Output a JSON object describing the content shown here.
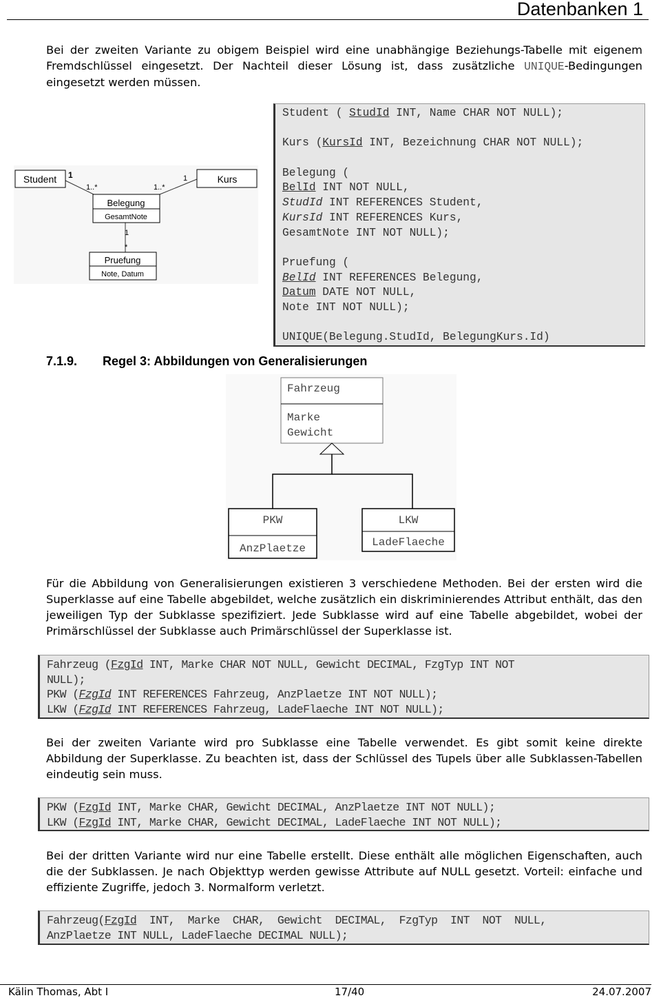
{
  "header": {
    "title": "Datenbanken 1"
  },
  "intro": {
    "before": "Bei der zweiten Variante zu obigem Beispiel wird eine unabhängige Beziehungs-Tabelle mit eigenem Fremdschlüssel eingesetzt. Der Nachteil dieser Lösung ist, dass zusätzliche ",
    "code": "UNIQUE",
    "after": "-Bedingungen eingesetzt werden müssen."
  },
  "uml1": {
    "classes": {
      "student": "Student",
      "kurs": "Kurs",
      "belegung": "Belegung",
      "belegung_attr": "GesamtNote",
      "pruefung": "Pruefung",
      "pruefung_attr": "Note, Datum"
    },
    "multiplicities": {
      "student_end": "1",
      "belegung_student_end": "1..*",
      "belegung_kurs_end": "1..*",
      "kurs_end": "1",
      "belegung_pruefung_end": "1",
      "pruefung_end": "*"
    }
  },
  "code1": [
    [
      {
        "t": "Student ( "
      },
      {
        "t": "StudId",
        "u": true
      },
      {
        "t": " INT, Name CHAR NOT NULL);"
      }
    ],
    [],
    [
      {
        "t": "Kurs ("
      },
      {
        "t": "KursId",
        "u": true
      },
      {
        "t": " INT, Bezeichnung CHAR NOT NULL);"
      }
    ],
    [],
    [
      {
        "t": "Belegung ("
      }
    ],
    [
      {
        "t": "BelId",
        "u": true
      },
      {
        "t": " INT NOT NULL,"
      }
    ],
    [
      {
        "t": "StudId",
        "i": true
      },
      {
        "t": " INT REFERENCES Student,"
      }
    ],
    [
      {
        "t": "KursId",
        "i": true
      },
      {
        "t": " INT REFERENCES Kurs,"
      }
    ],
    [
      {
        "t": "GesamtNote INT NOT NULL);"
      }
    ],
    [],
    [
      {
        "t": "Pruefung ("
      }
    ],
    [
      {
        "t": "BelId",
        "u": true,
        "i": true
      },
      {
        "t": " INT REFERENCES Belegung,"
      }
    ],
    [
      {
        "t": "Datum",
        "u": true
      },
      {
        "t": " DATE NOT NULL,"
      }
    ],
    [
      {
        "t": "Note INT NOT NULL);"
      }
    ],
    [],
    [
      {
        "t": "UNIQUE(Belegung.StudId, BelegungKurs.Id)"
      }
    ]
  ],
  "section": {
    "number": "7.1.9.",
    "title": "Regel 3: Abbildungen von Generalisierungen"
  },
  "uml2": {
    "super": "Fahrzeug",
    "super_attrs": [
      "Marke",
      "Gewicht"
    ],
    "sub1": "PKW",
    "sub1_attr": "AnzPlaetze",
    "sub2": "LKW",
    "sub2_attr": "LadeFlaeche"
  },
  "para1": "Für die Abbildung von Generalisierungen existieren 3 verschiedene Methoden. Bei der ersten wird die Superklasse auf eine  Tabelle abgebildet, welche zusätzlich ein diskriminierendes Attribut enthält, das den jeweiligen Typ der Subklasse spezifiziert. Jede Subklasse wird auf eine Tabelle abgebildet, wobei der Primärschlüssel der Subklasse auch Primärschlüssel der Superklasse ist.",
  "code2": [
    [
      {
        "t": "Fahrzeug ("
      },
      {
        "t": "FzgId",
        "u": true
      },
      {
        "t": " INT, Marke CHAR NOT NULL, Gewicht DECIMAL, FzgTyp INT NOT"
      }
    ],
    [
      {
        "t": "NULL);"
      }
    ],
    [
      {
        "t": "PKW ("
      },
      {
        "t": "FzgId",
        "u": true,
        "i": true
      },
      {
        "t": " INT REFERENCES Fahrzeug, AnzPlaetze INT NOT NULL);"
      }
    ],
    [
      {
        "t": "LKW ("
      },
      {
        "t": "FzgId",
        "u": true,
        "i": true
      },
      {
        "t": " INT REFERENCES Fahrzeug, LadeFlaeche INT NOT NULL);"
      }
    ]
  ],
  "para2": "Bei der zweiten Variante wird pro Subklasse eine Tabelle verwendet. Es gibt somit keine direkte Abbildung der Superklasse. Zu beachten ist, dass der Schlüssel des Tupels über alle Subklassen-Tabellen eindeutig sein muss.",
  "code3": [
    [
      {
        "t": "PKW ("
      },
      {
        "t": "FzgId",
        "u": true
      },
      {
        "t": " INT, Marke CHAR, Gewicht DECIMAL, AnzPlaetze INT NOT NULL);"
      }
    ],
    [
      {
        "t": "LKW ("
      },
      {
        "t": "FzgId",
        "u": true
      },
      {
        "t": " INT, Marke CHAR, Gewicht DECIMAL, LadeFlaeche INT NOT NULL);"
      }
    ]
  ],
  "para3": "Bei der dritten Variante wird nur eine Tabelle erstellt. Diese enthält alle möglichen Eigenschaften, auch die der Subklassen. Je nach Objekttyp werden gewisse Attribute auf NULL gesetzt. Vorteil: einfache und effiziente Zugriffe, jedoch 3. Normalform verletzt.",
  "code4": [
    [
      {
        "t": "Fahrzeug("
      },
      {
        "t": "FzgId",
        "u": true
      },
      {
        "t": "  INT,  Marke  CHAR,  Gewicht  DECIMAL,  FzgTyp  INT  NOT  NULL,"
      }
    ],
    [
      {
        "t": "AnzPlaetze INT NULL, LadeFlaeche DECIMAL NULL);"
      }
    ]
  ],
  "footer": {
    "author": "Kälin Thomas, Abt I",
    "page": "17/40",
    "date": "24.07.2007"
  }
}
